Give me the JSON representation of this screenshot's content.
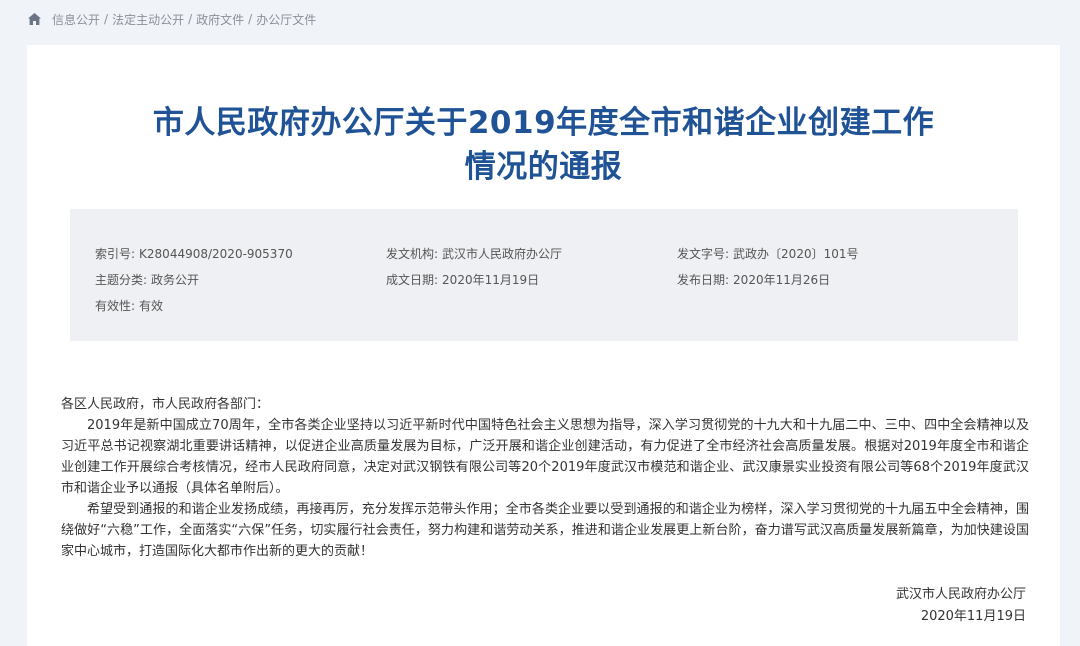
{
  "breadcrumb": {
    "items": [
      "信息公开",
      "法定主动公开",
      "政府文件",
      "办公厅文件"
    ],
    "separator": "/",
    "home_icon": "home-icon"
  },
  "document": {
    "title_line1": "市人民政府办公厅关于2019年度全市和谐企业创建工作",
    "title_line2": "情况的通报",
    "meta": {
      "index_label": "索引号:",
      "index_value": "K28044908/2020-905370",
      "issuer_label": "发文机构:",
      "issuer_value": "武汉市人民政府办公厅",
      "doc_no_label": "发文字号:",
      "doc_no_value": "武政办〔2020〕101号",
      "category_label": "主题分类:",
      "category_value": "政务公开",
      "created_label": "成文日期:",
      "created_value": "2020年11月19日",
      "published_label": "发布日期:",
      "published_value": "2020年11月26日",
      "validity_label": "有效性:",
      "validity_value": "有效"
    },
    "salutation": "各区人民政府，市人民政府各部门：",
    "paragraphs": [
      "2019年是新中国成立70周年，全市各类企业坚持以习近平新时代中国特色社会主义思想为指导，深入学习贯彻党的十九大和十九届二中、三中、四中全会精神以及习近平总书记视察湖北重要讲话精神，以促进企业高质量发展为目标，广泛开展和谐企业创建活动，有力促进了全市经济社会高质量发展。根据对2019年度全市和谐企业创建工作开展综合考核情况，经市人民政府同意，决定对武汉钢铁有限公司等20个2019年度武汉市模范和谐企业、武汉康景实业投资有限公司等68个2019年度武汉市和谐企业予以通报（具体名单附后）。",
      "希望受到通报的和谐企业发扬成绩，再接再厉，充分发挥示范带头作用；全市各类企业要以受到通报的和谐企业为榜样，深入学习贯彻党的十九届五中全会精神，围绕做好“六稳”工作，全面落实“六保”任务，切实履行社会责任，努力构建和谐劳动关系，推进和谐企业发展更上新台阶，奋力谱写武汉高质量发展新篇章，为加快建设国家中心城市，打造国际化大都市作出新的更大的贡献！"
    ],
    "signature_org": "武汉市人民政府办公厅",
    "signature_date": "2020年11月19日"
  },
  "colors": {
    "page_background": "#f0f4f9",
    "title": "#1f5395",
    "meta_background": "#eef0f3",
    "breadcrumb_text": "#8a8f99"
  }
}
